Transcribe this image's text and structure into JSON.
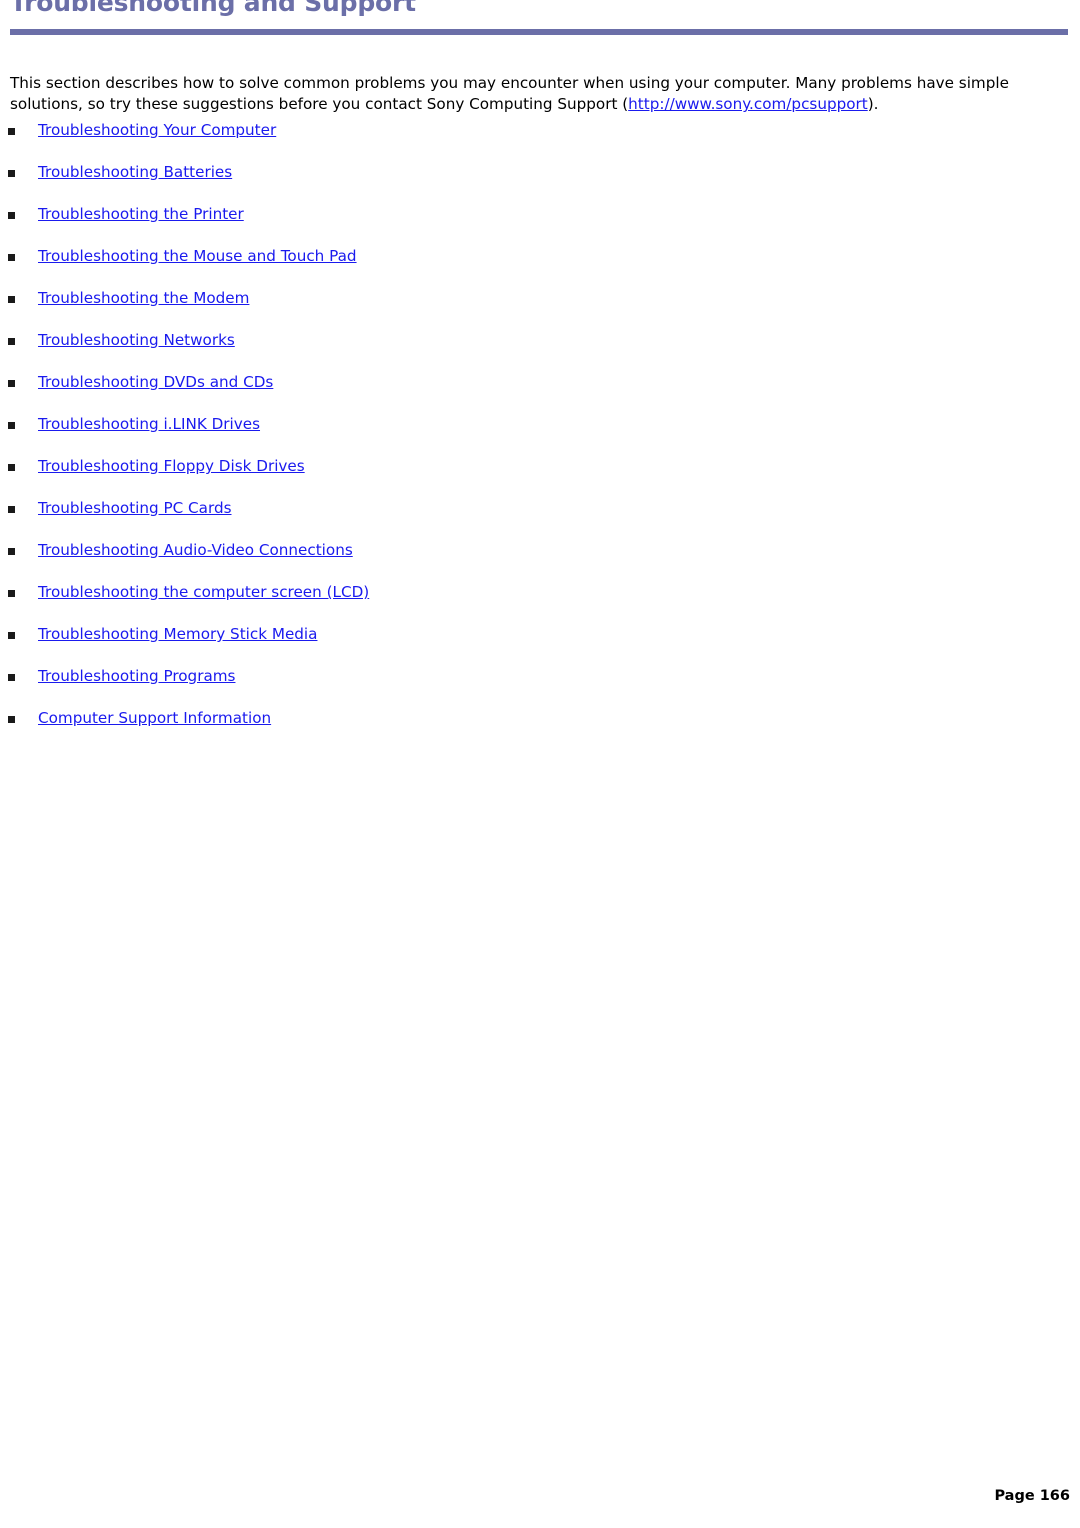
{
  "heading": {
    "title": "Troubleshooting and Support",
    "rule_color": "#6b6fa8",
    "title_color": "#6b6fa8"
  },
  "intro": {
    "text_before_link": "This section describes how to solve common problems you may encounter when using your computer. Many problems have simple solutions, so try these suggestions before you contact Sony Computing Support (",
    "link_text": "http://www.sony.com/pcsupport",
    "text_after_link": ")."
  },
  "link_list": {
    "bullet_glyph": "square-bullet",
    "link_color": "#1a1aee",
    "items": [
      {
        "label": "Troubleshooting Your Computer"
      },
      {
        "label": "Troubleshooting Batteries"
      },
      {
        "label": "Troubleshooting the Printer"
      },
      {
        "label": "Troubleshooting the Mouse and Touch Pad"
      },
      {
        "label": "Troubleshooting the Modem"
      },
      {
        "label": "Troubleshooting Networks"
      },
      {
        "label": "Troubleshooting DVDs and CDs"
      },
      {
        "label": "Troubleshooting i.LINK Drives"
      },
      {
        "label": "Troubleshooting Floppy Disk Drives"
      },
      {
        "label": "Troubleshooting PC Cards"
      },
      {
        "label": "Troubleshooting Audio-Video Connections"
      },
      {
        "label": "Troubleshooting the computer screen (LCD)"
      },
      {
        "label": "Troubleshooting Memory Stick Media"
      },
      {
        "label": "Troubleshooting Programs"
      },
      {
        "label": "Computer Support Information"
      }
    ]
  },
  "footer": {
    "page_label": "Page 166"
  }
}
